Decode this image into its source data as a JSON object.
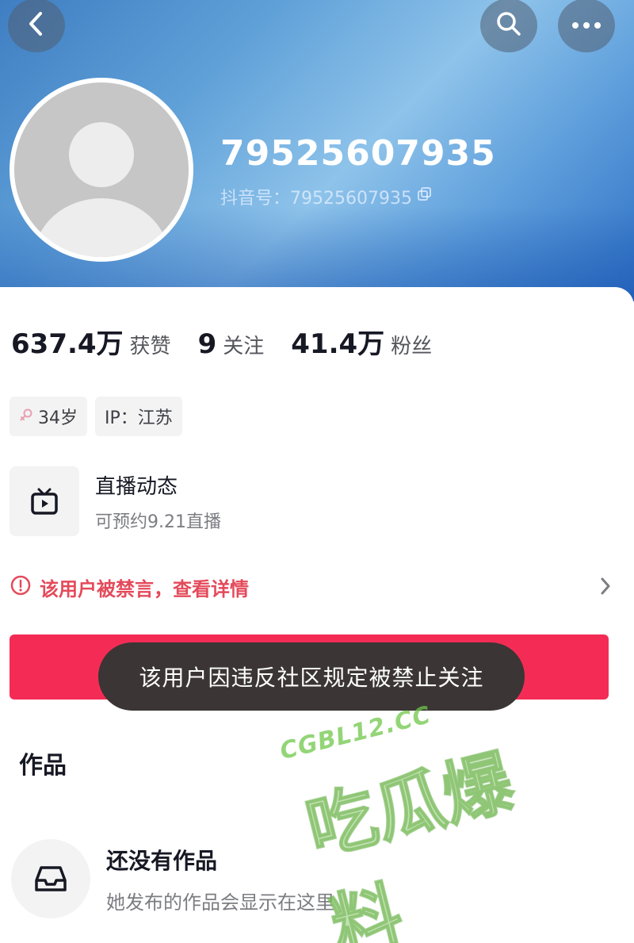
{
  "profile": {
    "nickname": "79525607935",
    "douyin_id": "抖音号：79525607935"
  },
  "stats": [
    {
      "value": "637.4万",
      "label": "获赞"
    },
    {
      "value": "9",
      "label": "关注"
    },
    {
      "value": "41.4万",
      "label": "粉丝"
    }
  ],
  "tags": {
    "age": "34岁",
    "ip": "IP：江苏"
  },
  "live": {
    "title": "直播动态",
    "subtitle": "可预约9.21直播"
  },
  "ban": {
    "text": "该用户被禁言，查看详情"
  },
  "toast": {
    "text": "该用户因违反社区规定被禁止关注"
  },
  "works": {
    "title": "作品",
    "empty_title": "还没有作品",
    "empty_subtitle": "她发布的作品会显示在这里"
  },
  "watermark": {
    "site": "CGBL12.CC",
    "logo": "吃瓜爆料"
  },
  "colors": {
    "accent_red": "#f42c55",
    "warning_red": "#e44a5a",
    "header_blue": "#3f7ec2"
  }
}
